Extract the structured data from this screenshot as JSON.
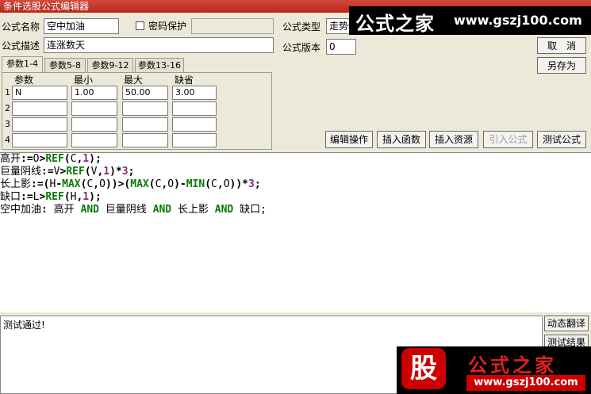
{
  "window": {
    "title": "条件选股公式编辑器"
  },
  "form": {
    "name_label": "公式名称",
    "name_value": "空中加油",
    "password_label": "密码保护",
    "password_checked": false,
    "desc_label": "公式描述",
    "desc_value": "连涨数天",
    "type_label": "公式类型",
    "type_value": "走势特",
    "version_label": "公式版本",
    "version_value": "0"
  },
  "buttons": {
    "cancel": "取　消",
    "save_as": "另存为",
    "edit_op": "编辑操作",
    "insert_func": "插入函数",
    "insert_res": "插入资源",
    "import": "引入公式",
    "test": "测试公式",
    "dyn_translate": "动态翻译",
    "test_result": "测试结果"
  },
  "tabs": [
    "参数1-4",
    "参数5-8",
    "参数9-12",
    "参数13-16"
  ],
  "params": {
    "headers": [
      "参数",
      "最小",
      "最大",
      "缺省"
    ],
    "row_numbers": [
      "1",
      "2",
      "3",
      "4"
    ],
    "rows": [
      [
        "N",
        "1.00",
        "50.00",
        "3.00"
      ],
      [
        "",
        "",
        "",
        ""
      ],
      [
        "",
        "",
        "",
        ""
      ],
      [
        "",
        "",
        "",
        ""
      ]
    ]
  },
  "code": [
    [
      {
        "t": "高开",
        "c": "id"
      },
      {
        "t": ":=",
        "c": "op"
      },
      {
        "t": "O",
        "c": "id"
      },
      {
        "t": ">",
        "c": "op"
      },
      {
        "t": "REF",
        "c": "kw"
      },
      {
        "t": "(",
        "c": "op"
      },
      {
        "t": "C",
        "c": "id"
      },
      {
        "t": ",",
        "c": "op"
      },
      {
        "t": "1",
        "c": "num"
      },
      {
        "t": ");",
        "c": "op"
      }
    ],
    [
      {
        "t": "巨量阴线",
        "c": "id"
      },
      {
        "t": ":=",
        "c": "op"
      },
      {
        "t": "V",
        "c": "id"
      },
      {
        "t": ">",
        "c": "op"
      },
      {
        "t": "REF",
        "c": "kw"
      },
      {
        "t": "(",
        "c": "op"
      },
      {
        "t": "V",
        "c": "id"
      },
      {
        "t": ",",
        "c": "op"
      },
      {
        "t": "1",
        "c": "num"
      },
      {
        "t": ")*",
        "c": "op"
      },
      {
        "t": "3",
        "c": "num"
      },
      {
        "t": ";",
        "c": "op"
      }
    ],
    [
      {
        "t": "长上影",
        "c": "id"
      },
      {
        "t": ":=(",
        "c": "op"
      },
      {
        "t": "H",
        "c": "id"
      },
      {
        "t": "-",
        "c": "op"
      },
      {
        "t": "MAX",
        "c": "kw"
      },
      {
        "t": "(",
        "c": "op"
      },
      {
        "t": "C",
        "c": "id"
      },
      {
        "t": ",",
        "c": "op"
      },
      {
        "t": "O",
        "c": "id"
      },
      {
        "t": "))>(",
        "c": "op"
      },
      {
        "t": "MAX",
        "c": "kw"
      },
      {
        "t": "(",
        "c": "op"
      },
      {
        "t": "C",
        "c": "id"
      },
      {
        "t": ",",
        "c": "op"
      },
      {
        "t": "O",
        "c": "id"
      },
      {
        "t": ")-",
        "c": "op"
      },
      {
        "t": "MIN",
        "c": "kw"
      },
      {
        "t": "(",
        "c": "op"
      },
      {
        "t": "C",
        "c": "id"
      },
      {
        "t": ",",
        "c": "op"
      },
      {
        "t": "O",
        "c": "id"
      },
      {
        "t": "))*",
        "c": "op"
      },
      {
        "t": "3",
        "c": "num"
      },
      {
        "t": ";",
        "c": "op"
      }
    ],
    [
      {
        "t": "缺口",
        "c": "id"
      },
      {
        "t": ":=",
        "c": "op"
      },
      {
        "t": "L",
        "c": "id"
      },
      {
        "t": ">",
        "c": "op"
      },
      {
        "t": "REF",
        "c": "kw"
      },
      {
        "t": "(",
        "c": "op"
      },
      {
        "t": "H",
        "c": "id"
      },
      {
        "t": ",",
        "c": "op"
      },
      {
        "t": "1",
        "c": "num"
      },
      {
        "t": ");",
        "c": "op"
      }
    ],
    [
      {
        "t": "空中加油",
        "c": "id"
      },
      {
        "t": ": ",
        "c": "op"
      },
      {
        "t": "高开 ",
        "c": "id"
      },
      {
        "t": "AND",
        "c": "kw"
      },
      {
        "t": " 巨量阴线 ",
        "c": "id"
      },
      {
        "t": "AND",
        "c": "kw"
      },
      {
        "t": " 长上影 ",
        "c": "id"
      },
      {
        "t": "AND",
        "c": "kw"
      },
      {
        "t": " 缺口;",
        "c": "id"
      }
    ]
  ],
  "output": {
    "text": "测试通过!"
  },
  "watermark": {
    "top_text": "公式之家",
    "top_url": "www.gszj100.com",
    "bottom_logo": "股",
    "bottom_text": "公式之家",
    "bottom_url": "www.gszj100.com"
  }
}
